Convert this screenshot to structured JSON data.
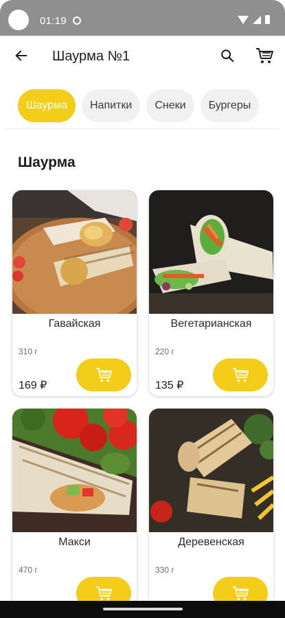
{
  "status_bar": {
    "time": "01:19"
  },
  "app_bar": {
    "title": "Шаурма №1",
    "back_icon": "arrow-left-icon",
    "search_icon": "search-icon",
    "cart_icon": "cart-icon"
  },
  "categories": [
    {
      "label": "Шаурма",
      "active": true
    },
    {
      "label": "Напитки",
      "active": false
    },
    {
      "label": "Снеки",
      "active": false
    },
    {
      "label": "Бургеры",
      "active": false
    }
  ],
  "section": {
    "title": "Шаурма"
  },
  "products": [
    {
      "name": "Гавайская",
      "weight": "310 г",
      "price": "169 ₽"
    },
    {
      "name": "Вегетарианская",
      "weight": "220 г",
      "price": "135 ₽"
    },
    {
      "name": "Макси",
      "weight": "470 г"
    },
    {
      "name": "Деревенская",
      "weight": "330 г"
    }
  ],
  "colors": {
    "accent": "#f3cd18",
    "chip_bg": "#f1f1f1",
    "status_bar": "#8f8f8f"
  }
}
